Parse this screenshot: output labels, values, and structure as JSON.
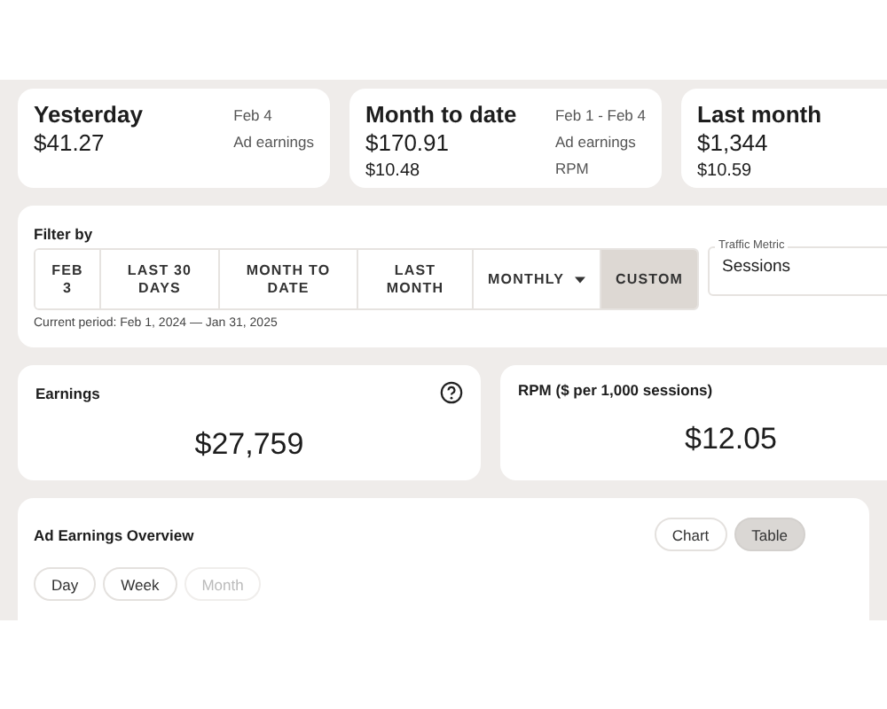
{
  "summary_cards": [
    {
      "title": "Yesterday",
      "value": "$41.27",
      "date": "Feb 4",
      "value_label": "Ad earnings"
    },
    {
      "title": "Month to date",
      "value": "$170.91",
      "date": "Feb 1 - Feb 4",
      "value_label": "Ad earnings",
      "secondary_value": "$10.48",
      "secondary_label": "RPM"
    },
    {
      "title": "Last month",
      "value": "$1,344",
      "secondary_value": "$10.59"
    }
  ],
  "filter": {
    "label": "Filter by",
    "periods": [
      {
        "label": "FEB 3",
        "selected": false,
        "dropdown": false
      },
      {
        "label": "LAST 30 DAYS",
        "selected": false,
        "dropdown": false
      },
      {
        "label": "MONTH TO DATE",
        "selected": false,
        "dropdown": false
      },
      {
        "label": "LAST MONTH",
        "selected": false,
        "dropdown": false
      },
      {
        "label": "MONTHLY",
        "selected": false,
        "dropdown": true
      },
      {
        "label": "CUSTOM",
        "selected": true,
        "dropdown": false
      }
    ],
    "current_period": "Current period: Feb 1, 2024 — Jan 31, 2025",
    "traffic_metric": {
      "label": "Traffic Metric",
      "value": "Sessions"
    }
  },
  "metrics": [
    {
      "title": "Earnings",
      "value": "$27,759",
      "help": true
    },
    {
      "title": "RPM ($ per 1,000 sessions)",
      "value": "$12.05",
      "help": false
    }
  ],
  "overview": {
    "title": "Ad Earnings Overview",
    "views": [
      {
        "label": "Chart",
        "selected": false
      },
      {
        "label": "Table",
        "selected": true
      }
    ],
    "granularity": [
      {
        "label": "Day",
        "disabled": false
      },
      {
        "label": "Week",
        "disabled": false
      },
      {
        "label": "Month",
        "disabled": true
      }
    ]
  }
}
